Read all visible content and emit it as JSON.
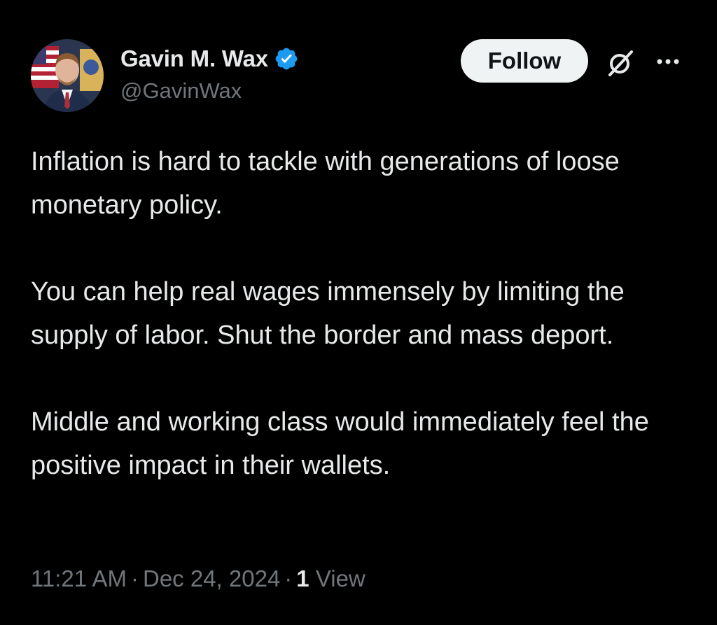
{
  "author": {
    "display_name": "Gavin M. Wax",
    "handle": "@GavinWax",
    "verified": true,
    "avatar_icon": "profile-photo"
  },
  "actions": {
    "follow_label": "Follow",
    "grok_icon": "grok-icon",
    "more_icon": "more-icon"
  },
  "tweet": {
    "paragraphs": [
      "Inflation is hard to tackle with generations of loose monetary policy.",
      "You can help real wages immensely by limiting the supply of labor. Shut the border and mass deport.",
      "Middle and working class would immediately feel the positive impact in their wallets."
    ]
  },
  "meta": {
    "time": "11:21 AM",
    "separator": "·",
    "date": "Dec 24, 2024",
    "views_count": "1",
    "views_label": "View"
  },
  "colors": {
    "background": "#000000",
    "text_primary": "#e7e9ea",
    "text_secondary": "#71767b",
    "verified_blue": "#1d9bf0",
    "follow_bg": "#eff3f4"
  }
}
